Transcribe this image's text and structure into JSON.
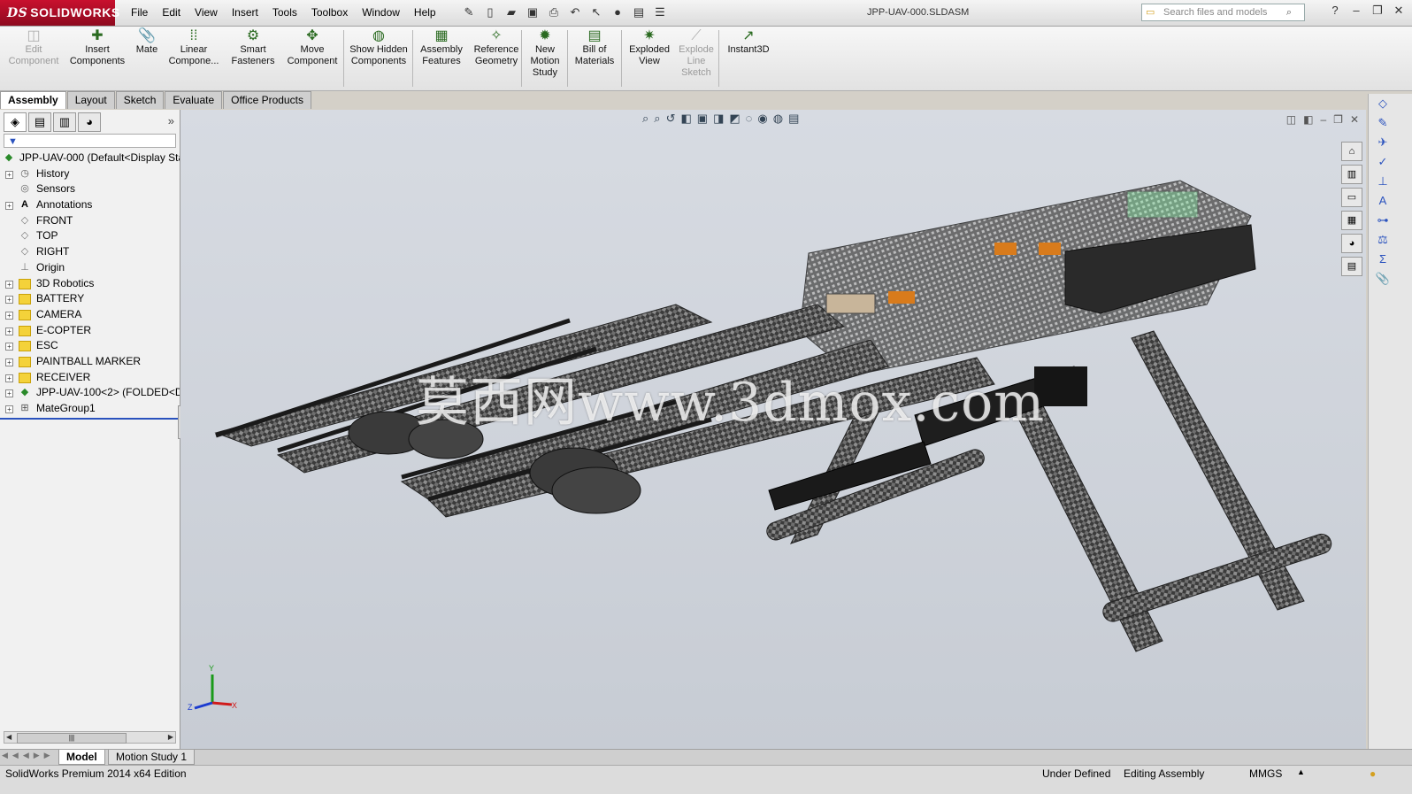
{
  "app": {
    "brand": "SOLIDWORKS",
    "doc_title": "JPP-UAV-000.SLDASM"
  },
  "menu": [
    "File",
    "Edit",
    "View",
    "Insert",
    "Tools",
    "Toolbox",
    "Window",
    "Help"
  ],
  "search": {
    "placeholder": "Search files and models"
  },
  "toolbar": [
    {
      "label": "Edit Component",
      "icon": "edit-component-icon",
      "disabled": true
    },
    {
      "label": "Insert Components",
      "icon": "insert-components-icon",
      "disabled": false
    },
    {
      "label": "Mate",
      "icon": "mate-icon",
      "disabled": false
    },
    {
      "label": "Linear Compone...",
      "icon": "linear-pattern-icon",
      "disabled": false
    },
    {
      "label": "Smart Fasteners",
      "icon": "smart-fasteners-icon",
      "disabled": false
    },
    {
      "label": "Move Component",
      "icon": "move-component-icon",
      "disabled": false
    },
    {
      "label": "Show Hidden Components",
      "icon": "show-hidden-icon",
      "disabled": false
    },
    {
      "label": "Assembly Features",
      "icon": "assembly-features-icon",
      "disabled": false
    },
    {
      "label": "Reference Geometry",
      "icon": "reference-geometry-icon",
      "disabled": false
    },
    {
      "label": "New Motion Study",
      "icon": "motion-study-icon",
      "disabled": false
    },
    {
      "label": "Bill of Materials",
      "icon": "bom-icon",
      "disabled": false
    },
    {
      "label": "Exploded View",
      "icon": "exploded-view-icon",
      "disabled": false
    },
    {
      "label": "Explode Line Sketch",
      "icon": "explode-line-icon",
      "disabled": true
    },
    {
      "label": "Instant3D",
      "icon": "instant3d-icon",
      "disabled": false
    }
  ],
  "cm_tabs": [
    "Assembly",
    "Layout",
    "Sketch",
    "Evaluate",
    "Office Products"
  ],
  "tree": [
    {
      "label": "JPP-UAV-000  (Default<Display Sta",
      "icon": "assembly-icon"
    },
    {
      "label": "History",
      "icon": "history-icon"
    },
    {
      "label": "Sensors",
      "icon": "sensors-icon"
    },
    {
      "label": "Annotations",
      "icon": "annotations-icon"
    },
    {
      "label": "FRONT",
      "icon": "plane-icon"
    },
    {
      "label": "TOP",
      "icon": "plane-icon"
    },
    {
      "label": "RIGHT",
      "icon": "plane-icon"
    },
    {
      "label": "Origin",
      "icon": "origin-icon"
    },
    {
      "label": "3D Robotics",
      "icon": "folder-icon"
    },
    {
      "label": "BATTERY",
      "icon": "folder-icon"
    },
    {
      "label": "CAMERA",
      "icon": "folder-icon"
    },
    {
      "label": "E-COPTER",
      "icon": "folder-icon"
    },
    {
      "label": "ESC",
      "icon": "folder-icon"
    },
    {
      "label": "PAINTBALL MARKER",
      "icon": "folder-icon"
    },
    {
      "label": "RECEIVER",
      "icon": "folder-icon"
    },
    {
      "label": "JPP-UAV-100<2> (FOLDED<Di",
      "icon": "subassembly-icon"
    },
    {
      "label": "MateGroup1",
      "icon": "mategroup-icon"
    }
  ],
  "watermark": "莫西网www.3dmox.com",
  "triad": {
    "x": "X",
    "y": "Y",
    "z": "Z"
  },
  "bottom_tabs": [
    "Model",
    "Motion Study 1"
  ],
  "status": {
    "edition": "SolidWorks Premium 2014 x64 Edition",
    "definition": "Under Defined",
    "mode": "Editing Assembly",
    "units": "MMGS"
  },
  "colors": {
    "brand": "#c8102e",
    "viewport_top": "#d7dbe2",
    "viewport_bottom": "#c7ccd4"
  }
}
